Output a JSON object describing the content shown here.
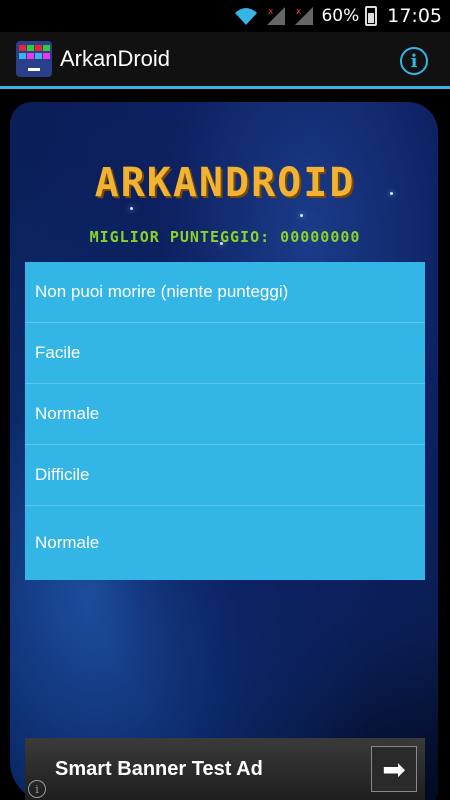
{
  "status_bar": {
    "battery": "60%",
    "time": "17:05",
    "icons": [
      "wifi-icon",
      "signal-icon",
      "signal-icon",
      "battery-icon"
    ]
  },
  "action_bar": {
    "title": "ArkanDroid",
    "app_icon": "arkanoid-app-icon",
    "info_icon": "info-icon"
  },
  "game": {
    "title": "ARKANDROID",
    "best_score": "MIGLIOR PUNTEGGIO: 00000000"
  },
  "menu": {
    "items": [
      {
        "label": "Non puoi morire (niente punteggi)"
      },
      {
        "label": "Facile"
      },
      {
        "label": "Normale"
      },
      {
        "label": "Difficile"
      },
      {
        "label": "Normale"
      }
    ]
  },
  "ad": {
    "text": "Smart Banner Test Ad",
    "arrow": "➡",
    "info": "i"
  },
  "colors": {
    "accent": "#33b5e5",
    "title": "#f2b233",
    "score": "#8ad32a"
  }
}
